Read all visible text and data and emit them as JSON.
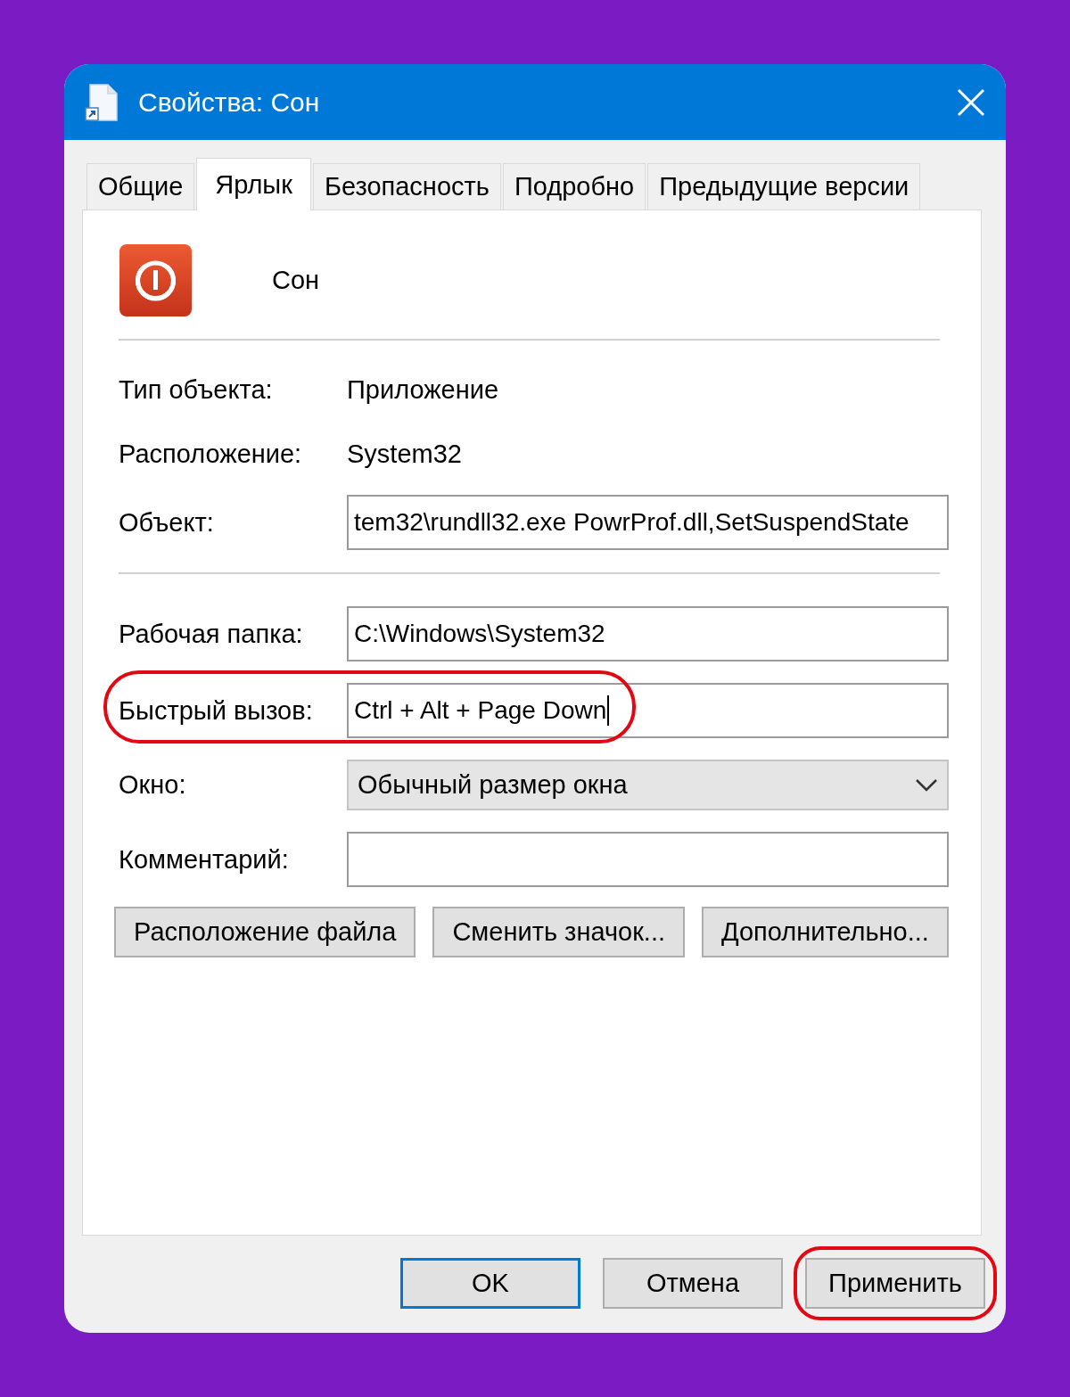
{
  "window": {
    "title": "Свойства: Сон"
  },
  "tabs": [
    {
      "label": "Общие",
      "selected": false
    },
    {
      "label": "Ярлык",
      "selected": true
    },
    {
      "label": "Безопасность",
      "selected": false
    },
    {
      "label": "Подробно",
      "selected": false
    },
    {
      "label": "Предыдущие версии",
      "selected": false
    }
  ],
  "shortcut": {
    "name": "Сон"
  },
  "info": [
    {
      "label": "Тип объекта:",
      "value": "Приложение"
    },
    {
      "label": "Расположение:",
      "value": "System32"
    }
  ],
  "target": {
    "label": "Объект:",
    "value": "tem32\\rundll32.exe PowrProf.dll,SetSuspendState"
  },
  "fields": [
    {
      "label": "Рабочая папка:",
      "kind": "text",
      "value": "C:\\Windows\\System32",
      "highlighted": false,
      "focused": false
    },
    {
      "label": "Быстрый вызов:",
      "kind": "text",
      "value": "Ctrl + Alt + Page Down",
      "highlighted": true,
      "focused": true
    },
    {
      "label": "Окно:",
      "kind": "dropdown",
      "value": "Обычный размер окна",
      "highlighted": false,
      "focused": false
    },
    {
      "label": "Комментарий:",
      "kind": "text",
      "highlighted": false,
      "focused": false
    }
  ],
  "action_buttons": [
    "Расположение файла",
    "Сменить значок...",
    "Дополнительно..."
  ],
  "dialog_buttons": [
    {
      "label": "OK",
      "default": true,
      "highlighted": false
    },
    {
      "label": "Отмена",
      "default": false,
      "highlighted": false
    },
    {
      "label": "Применить",
      "default": false,
      "highlighted": true
    }
  ]
}
